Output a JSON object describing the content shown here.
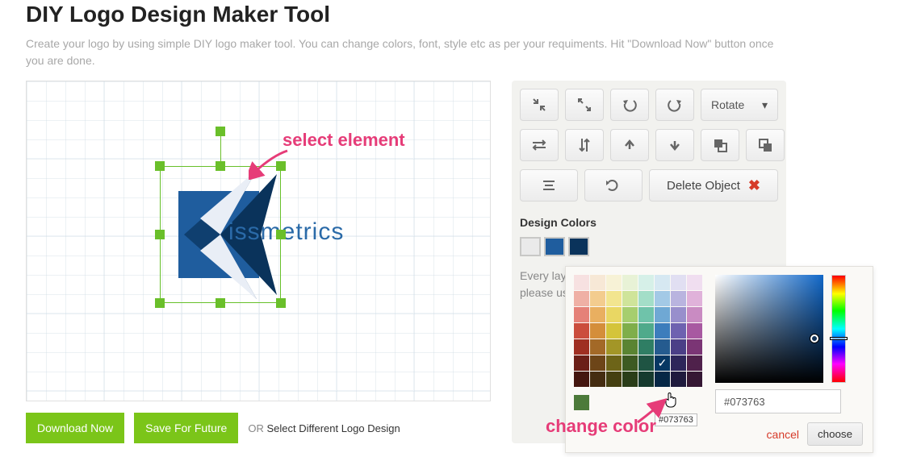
{
  "page_title": "DIY Logo Design Maker Tool",
  "subtitle": "Create your logo by using simple DIY logo maker tool. You can change colors, font, style etc as per your requiments. Hit \"Download Now\" button once you are done.",
  "canvas": {
    "logo_text": "issmetrics",
    "annotation_select": "select element"
  },
  "actions": {
    "download": "Download Now",
    "save": "Save For Future",
    "or_prefix": "OR ",
    "or_link": "Select Different Logo Design"
  },
  "toolbar": {
    "rotate_label": "Rotate",
    "delete_label": "Delete Object"
  },
  "colors": {
    "section_title": "Design Colors",
    "swatches": [
      "#eaeaea",
      "#1f5d9e",
      "#0a335b"
    ],
    "hint_line1": "Every layer",
    "hint_line2": "please use"
  },
  "picker": {
    "selected_hex_label": "#073763",
    "hex_input_value": "#073763",
    "cancel": "cancel",
    "choose": "choose",
    "annotation_change": "change color"
  }
}
